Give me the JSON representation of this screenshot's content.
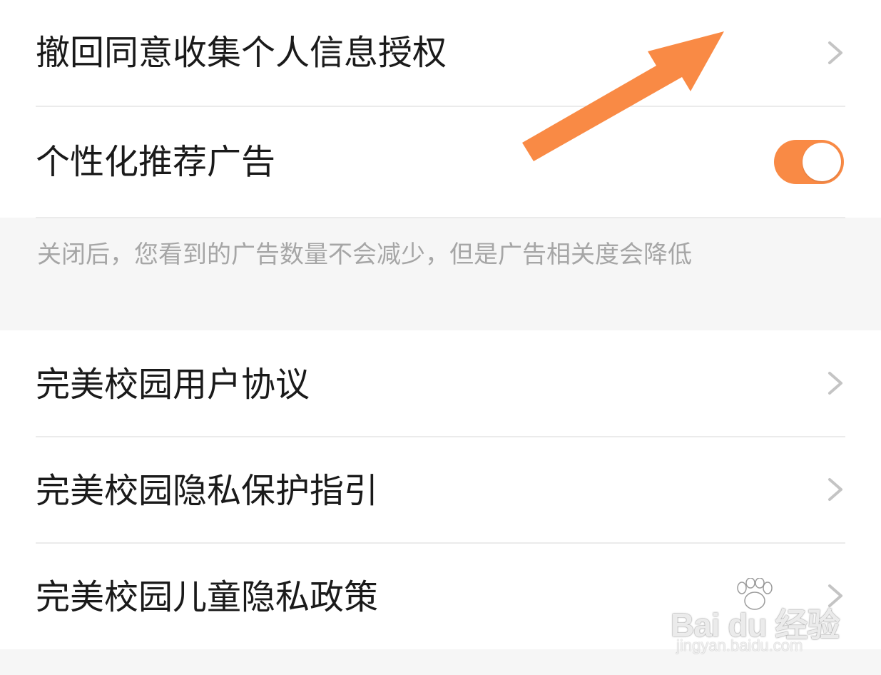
{
  "privacy_settings": {
    "revoke_consent": {
      "label": "撤回同意收集个人信息授权",
      "icon": "chevron-right-icon"
    },
    "personalized_ads": {
      "label": "个性化推荐广告",
      "toggle_on": true,
      "toggle_color": "#f98a45"
    },
    "ads_hint": "关闭后，您看到的广告数量不会减少，但是广告相关度会降低"
  },
  "legal_links": [
    {
      "label": "完美校园用户协议",
      "icon": "chevron-right-icon"
    },
    {
      "label": "完美校园隐私保护指引",
      "icon": "chevron-right-icon"
    },
    {
      "label": "完美校园儿童隐私政策",
      "icon": "chevron-right-icon"
    }
  ],
  "annotation": {
    "arrow_color": "#f98a45"
  },
  "watermark": {
    "brand": "Bai du 经验",
    "url": "jingyan.baidu.com"
  }
}
